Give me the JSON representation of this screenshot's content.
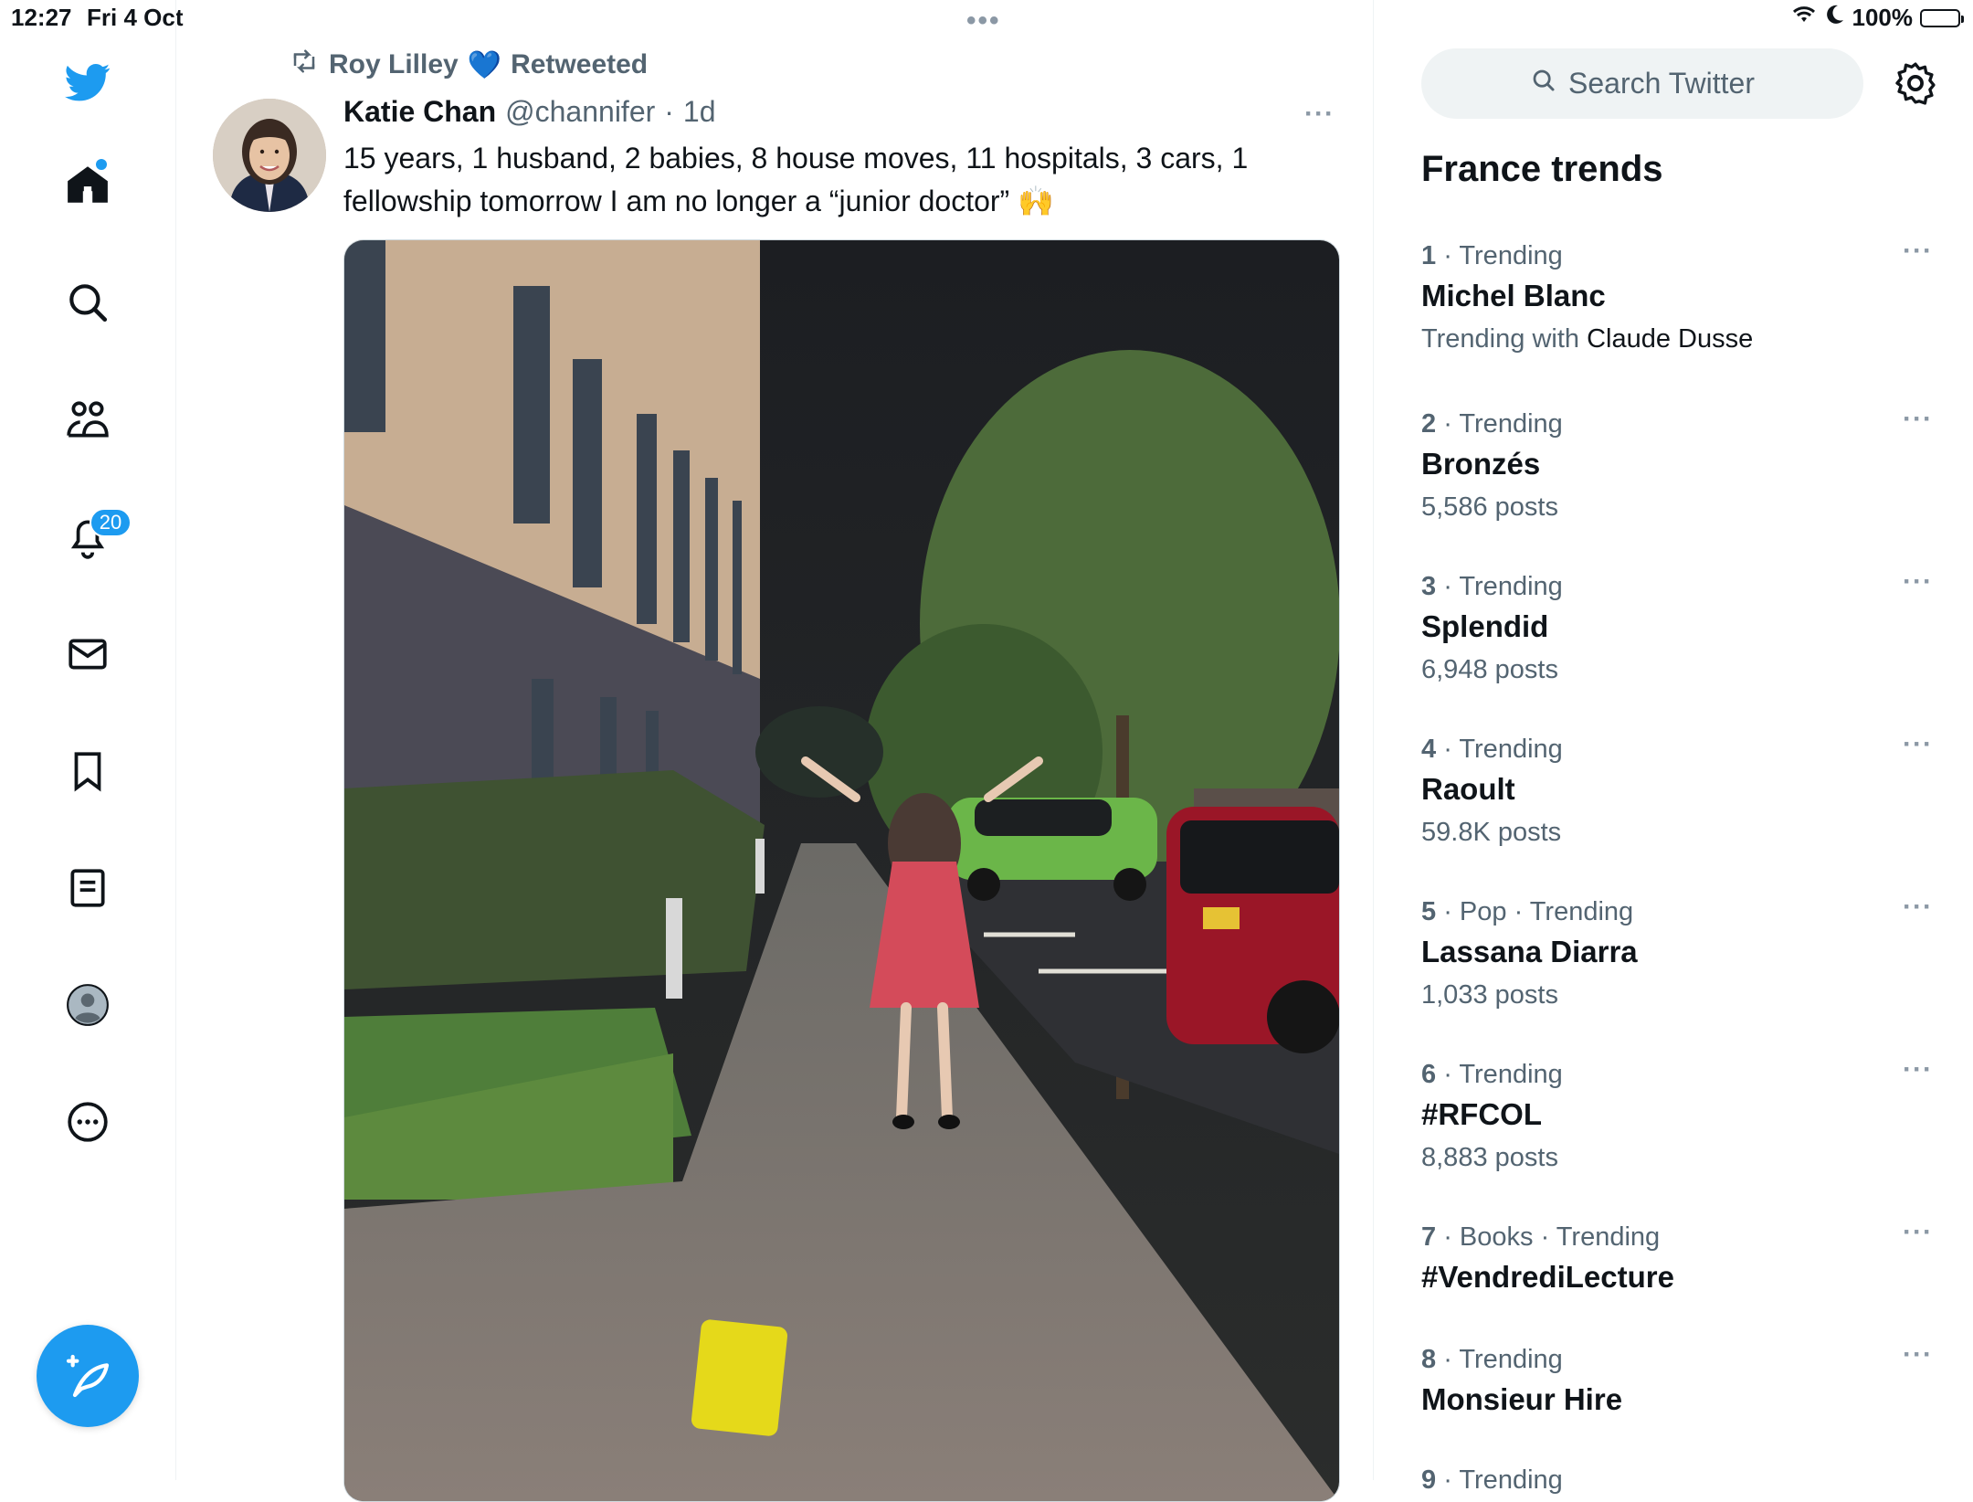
{
  "status": {
    "time": "12:27",
    "date": "Fri 4 Oct",
    "battery": "100%"
  },
  "top_dots": "•••",
  "nav": {
    "notifications_badge": "20"
  },
  "tweet": {
    "retweeted_by": "Roy Lilley",
    "retweeted_heart": "💙",
    "retweeted_label": "Retweeted",
    "author_name": "Katie Chan",
    "author_handle": "@channifer",
    "separator": "·",
    "age": "1d",
    "more": "···",
    "text": "15 years, 1 husband, 2 babies, 8 house moves, 11 hospitals, 3 cars, 1 fellowship tomorrow I am no longer a “junior doctor” 🙌"
  },
  "search": {
    "placeholder": "Search Twitter"
  },
  "trends": {
    "title": "France trends",
    "items": [
      {
        "rank": "1",
        "context": "Trending",
        "title": "Michel Blanc",
        "sub_prefix": "Trending with ",
        "sub_with": "Claude Dusse"
      },
      {
        "rank": "2",
        "context": "Trending",
        "title": "Bronzés",
        "sub": "5,586 posts"
      },
      {
        "rank": "3",
        "context": "Trending",
        "title": "Splendid",
        "sub": "6,948 posts"
      },
      {
        "rank": "4",
        "context": "Trending",
        "title": "Raoult",
        "sub": "59.8K posts"
      },
      {
        "rank": "5",
        "context": "Pop · Trending",
        "title": "Lassana Diarra",
        "sub": "1,033 posts"
      },
      {
        "rank": "6",
        "context": "Trending",
        "title": "#RFCOL",
        "sub": "8,883 posts"
      },
      {
        "rank": "7",
        "context": "Books · Trending",
        "title": "#VendrediLecture",
        "sub": ""
      },
      {
        "rank": "8",
        "context": "Trending",
        "title": "Monsieur Hire",
        "sub": ""
      },
      {
        "rank": "9",
        "context": "Trending",
        "title": "",
        "sub": ""
      }
    ]
  },
  "colors": {
    "accent": "#1d9bf0",
    "text": "#0f1419",
    "muted": "#536471"
  }
}
